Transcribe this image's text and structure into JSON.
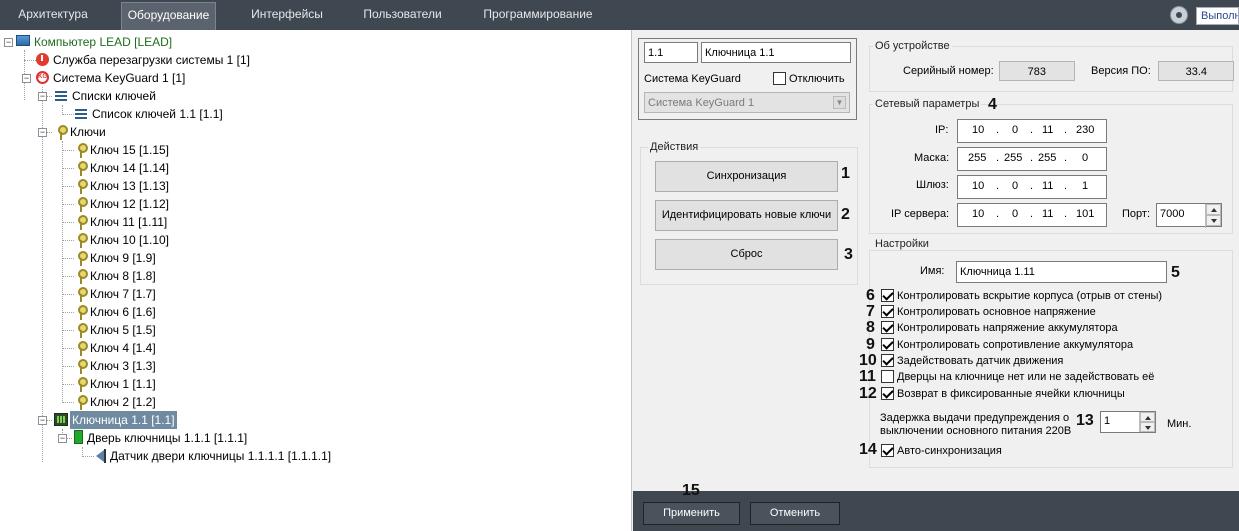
{
  "topbar": {
    "tabs": [
      "Архитектура",
      "Оборудование",
      "Интерфейсы",
      "Пользователи",
      "Программирование"
    ],
    "active_tab": "Оборудование",
    "run_button": "Выполн"
  },
  "tree": {
    "root": "Компьютер LEAD [LEAD]",
    "reboot_service": "Служба перезагрузки системы 1 [1]",
    "keyguard": "Система KeyGuard 1 [1]",
    "key_lists": "Списки ключей",
    "key_list_1": "Список ключей 1.1 [1.1]",
    "keys": "Ключи",
    "key_items": [
      "Ключ 15 [1.15]",
      "Ключ 14 [1.14]",
      "Ключ 13 [1.13]",
      "Ключ 12 [1.12]",
      "Ключ 11 [1.11]",
      "Ключ 10 [1.10]",
      "Ключ 9 [1.9]",
      "Ключ 8 [1.8]",
      "Ключ 7 [1.7]",
      "Ключ 6 [1.6]",
      "Ключ 5 [1.5]",
      "Ключ 4 [1.4]",
      "Ключ 3 [1.3]",
      "Ключ 1 [1.1]",
      "Ключ 2 [1.2]"
    ],
    "box": "Ключница 1.1 [1.1]",
    "door": "Дверь ключницы 1.1.1 [1.1.1]",
    "sensor": "Датчик двери ключницы 1.1.1.1 [1.1.1.1]"
  },
  "header": {
    "id": "1.1",
    "name": "Ключница 1.1",
    "parent_label": "Система KeyGuard",
    "disable_label": "Отключить",
    "parent_value": "Система KeyGuard 1"
  },
  "actions": {
    "title": "Действия",
    "sync": "Синхронизация",
    "identify": "Идентифицировать новые ключи",
    "reset": "Сброс"
  },
  "device": {
    "title": "Об устройстве",
    "serial_label": "Серийный номер:",
    "serial": "783",
    "fw_label": "Версия ПО:",
    "fw": "33.4"
  },
  "network": {
    "title": "Сетевый параметры",
    "ip_label": "IP:",
    "ip": [
      "10",
      "0",
      "11",
      "230"
    ],
    "mask_label": "Маска:",
    "mask": [
      "255",
      "255",
      "255",
      "0"
    ],
    "gw_label": "Шлюз:",
    "gw": [
      "10",
      "0",
      "11",
      "1"
    ],
    "server_label": "IP сервера:",
    "server": [
      "10",
      "0",
      "11",
      "101"
    ],
    "port_label": "Порт:",
    "port": "7000"
  },
  "settings": {
    "title": "Настройки",
    "name_label": "Имя:",
    "name": "Ключница 1.11",
    "checks": [
      {
        "label": "Контролировать вскрытие корпуса (отрыв от стены)",
        "checked": true
      },
      {
        "label": "Контролировать основное напряжение",
        "checked": true
      },
      {
        "label": "Контролировать напряжение аккумулятора",
        "checked": true
      },
      {
        "label": "Контролировать сопротивление аккумулятора",
        "checked": true
      },
      {
        "label": "Задействовать датчик движения",
        "checked": true
      },
      {
        "label": "Дверцы на ключнице нет или не задействовать её",
        "checked": false
      },
      {
        "label": "Возврат в фиксированные ячейки ключницы",
        "checked": true
      }
    ],
    "delay_label_1": "Задержка выдачи предупреждения о",
    "delay_label_2": "выключении основного питания 220В",
    "delay_value": "1",
    "delay_unit": "Мин.",
    "autosync": "Авто-синхронизация"
  },
  "numbers": [
    "1",
    "2",
    "3",
    "4",
    "5",
    "6",
    "7",
    "8",
    "9",
    "10",
    "11",
    "12",
    "13",
    "14",
    "15"
  ],
  "footer": {
    "apply": "Применить",
    "cancel": "Отменить"
  }
}
